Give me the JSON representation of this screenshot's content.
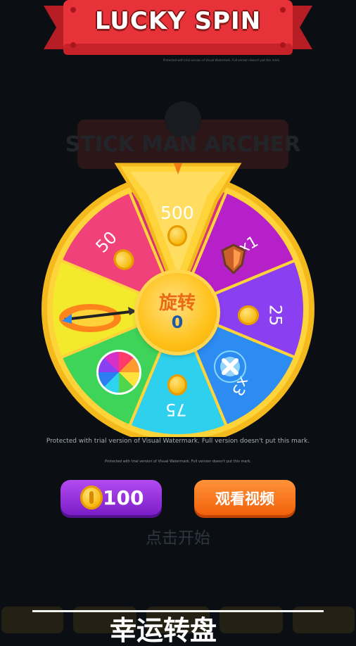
{
  "banner": {
    "title": "LUCKY SPIN",
    "note": "Protected with trial version of Visual Watermark. Full version doesn't put this mark."
  },
  "background": {
    "ghost_title": "STICK MAN ARCHER"
  },
  "wheel": {
    "segments": [
      {
        "label": "500",
        "reward": "coin",
        "color": "#d6307a"
      },
      {
        "label": "x1",
        "reward": "shield-icon",
        "color": "#b520c9"
      },
      {
        "label": "25",
        "reward": "coin",
        "color": "#8a3ff0"
      },
      {
        "label": "x3",
        "reward": "crosshair-icon",
        "color": "#2c8cf2"
      },
      {
        "label": "75",
        "reward": "coin",
        "color": "#2fd0ee"
      },
      {
        "label": "",
        "reward": "wheel-icon",
        "color": "#3ed45a"
      },
      {
        "label": "",
        "reward": "flaming-arrow-icon",
        "color": "#f2ea2a"
      },
      {
        "label": "50",
        "reward": "coin",
        "color": "#f0417a"
      }
    ],
    "hub_label": "旋转",
    "hub_count": "0"
  },
  "watermark": {
    "line1": "Protected with trial version of Visual Watermark. Full version doesn't put this mark.",
    "line2": "Protected with trial version of Visual Watermark. Full version doesn't put this mark."
  },
  "buttons": {
    "spin_cost": "100",
    "watch_video": "观看视频"
  },
  "tap_hint": "点击开始",
  "bottom_text": "幸运转盘"
}
